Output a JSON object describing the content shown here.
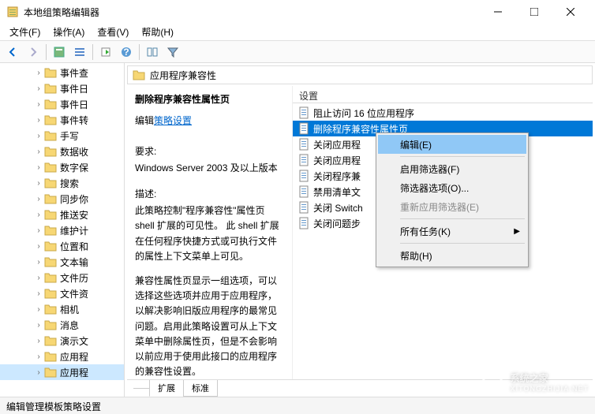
{
  "window": {
    "title": "本地组策略编辑器"
  },
  "menus": {
    "file": "文件(F)",
    "action": "操作(A)",
    "view": "查看(V)",
    "help": "帮助(H)"
  },
  "tree": {
    "items": [
      "事件查",
      "事件日",
      "事件日",
      "事件转",
      "手写",
      "数据收",
      "数字保",
      "搜索",
      "同步你",
      "推送安",
      "维护计",
      "位置和",
      "文本输",
      "文件历",
      "文件资",
      "相机",
      "消息",
      "演示文",
      "应用程",
      "应用程"
    ],
    "selectedIndex": 19
  },
  "content": {
    "headerTitle": "应用程序兼容性",
    "detailTitle": "删除程序兼容性属性页",
    "editLabel": "编辑",
    "policyLink": "策略设置",
    "reqLabel": "要求:",
    "reqText": "Windows Server 2003 及以上版本",
    "descLabel": "描述:",
    "desc1": "此策略控制\"程序兼容性\"属性页 shell 扩展的可见性。 此 shell 扩展在任何程序快捷方式或可执行文件的属性上下文菜单上可见。",
    "desc2": "兼容性属性页显示一组选项，可以选择这些选项并应用于应用程序，以解决影响旧版应用程序的最常见问题。启用此策略设置可从上下文菜单中删除属性页，但是不会影响以前应用于使用此接口的应用程序的兼容性设置。",
    "settingsHeader": "设置",
    "settings": [
      "阻止访问 16 位应用程序",
      "删除程序兼容性属性页",
      "关闭应用程",
      "关闭应用程",
      "关闭程序兼",
      "禁用清单文",
      "关闭 Switch",
      "关闭问题步"
    ],
    "highlightedIndex": 1
  },
  "contextMenu": {
    "edit": "编辑(E)",
    "filterOn": "启用筛选器(F)",
    "filterOpts": "筛选器选项(O)...",
    "reapply": "重新应用筛选器(E)",
    "allTasks": "所有任务(K)",
    "help": "帮助(H)"
  },
  "tabs": {
    "extended": "扩展",
    "standard": "标准"
  },
  "status": {
    "text": "编辑管理模板策略设置"
  },
  "watermark": {
    "brand": "系统之家",
    "sub": "XITONGZHIJIA.NET"
  }
}
